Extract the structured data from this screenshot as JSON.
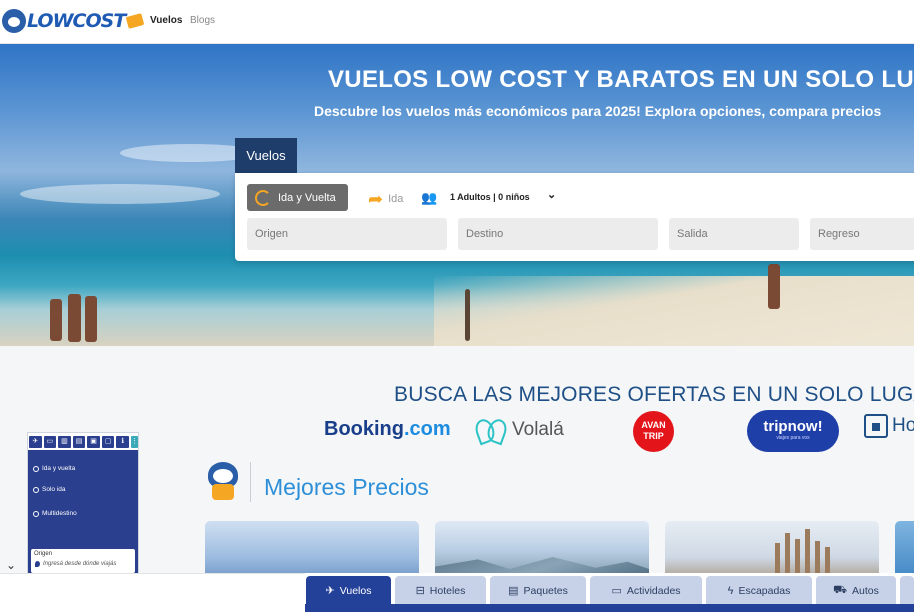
{
  "header": {
    "logo_text": "LOWCOST",
    "nav": [
      {
        "label": "Vuelos",
        "active": true
      },
      {
        "label": "Blogs",
        "active": false
      }
    ]
  },
  "hero": {
    "title": "VUELOS LOW COST Y BARATOS EN UN SOLO LUGAR",
    "subtitle": "Descubre los vuelos más económicos para 2025! Explora opciones, compara precios"
  },
  "search": {
    "tab_label": "Vuelos",
    "trip_type_active": "Ida y Vuelta",
    "trip_type_alt": "Ida",
    "passengers": "1 Adultos | 0 niños",
    "fields": {
      "origin": "Origen",
      "destination": "Destino",
      "departure": "Salida",
      "return": "Regreso"
    }
  },
  "offers": {
    "title": "BUSCA LAS MEJORES OFERTAS EN UN SOLO LUGAR",
    "brands": {
      "booking_main": "Booking",
      "booking_dot": ".com",
      "volala": "Volalá",
      "avantrip_line1": "AVAN",
      "avantrip_line2": "TRIP",
      "tripnow": "tripnow!",
      "tripnow_tag": "viajes para vos",
      "hoteles_partial": "Ho"
    }
  },
  "best_prices": {
    "title": "Mejores Precios"
  },
  "widget": {
    "options": [
      "Ida y vuelta",
      "Solo ida",
      "Multidestino"
    ],
    "origin_label": "Origen",
    "origin_placeholder": "Ingresá desde dónde viajás"
  },
  "bottom_tabs": [
    {
      "label": "Vuelos",
      "icon": "plane-icon",
      "active": true
    },
    {
      "label": "Hoteles",
      "icon": "bed-icon",
      "active": false
    },
    {
      "label": "Paquetes",
      "icon": "suitcase-icon",
      "active": false
    },
    {
      "label": "Actividades",
      "icon": "ticket-icon",
      "active": false
    },
    {
      "label": "Escapadas",
      "icon": "bolt-icon",
      "active": false
    },
    {
      "label": "Autos",
      "icon": "car-icon",
      "active": false
    }
  ],
  "colors": {
    "brand_blue": "#1f5bb3",
    "navy": "#24419a",
    "accent_orange": "#f5a623",
    "title_blue": "#1e4f86",
    "light_blue": "#2d8fd8"
  }
}
